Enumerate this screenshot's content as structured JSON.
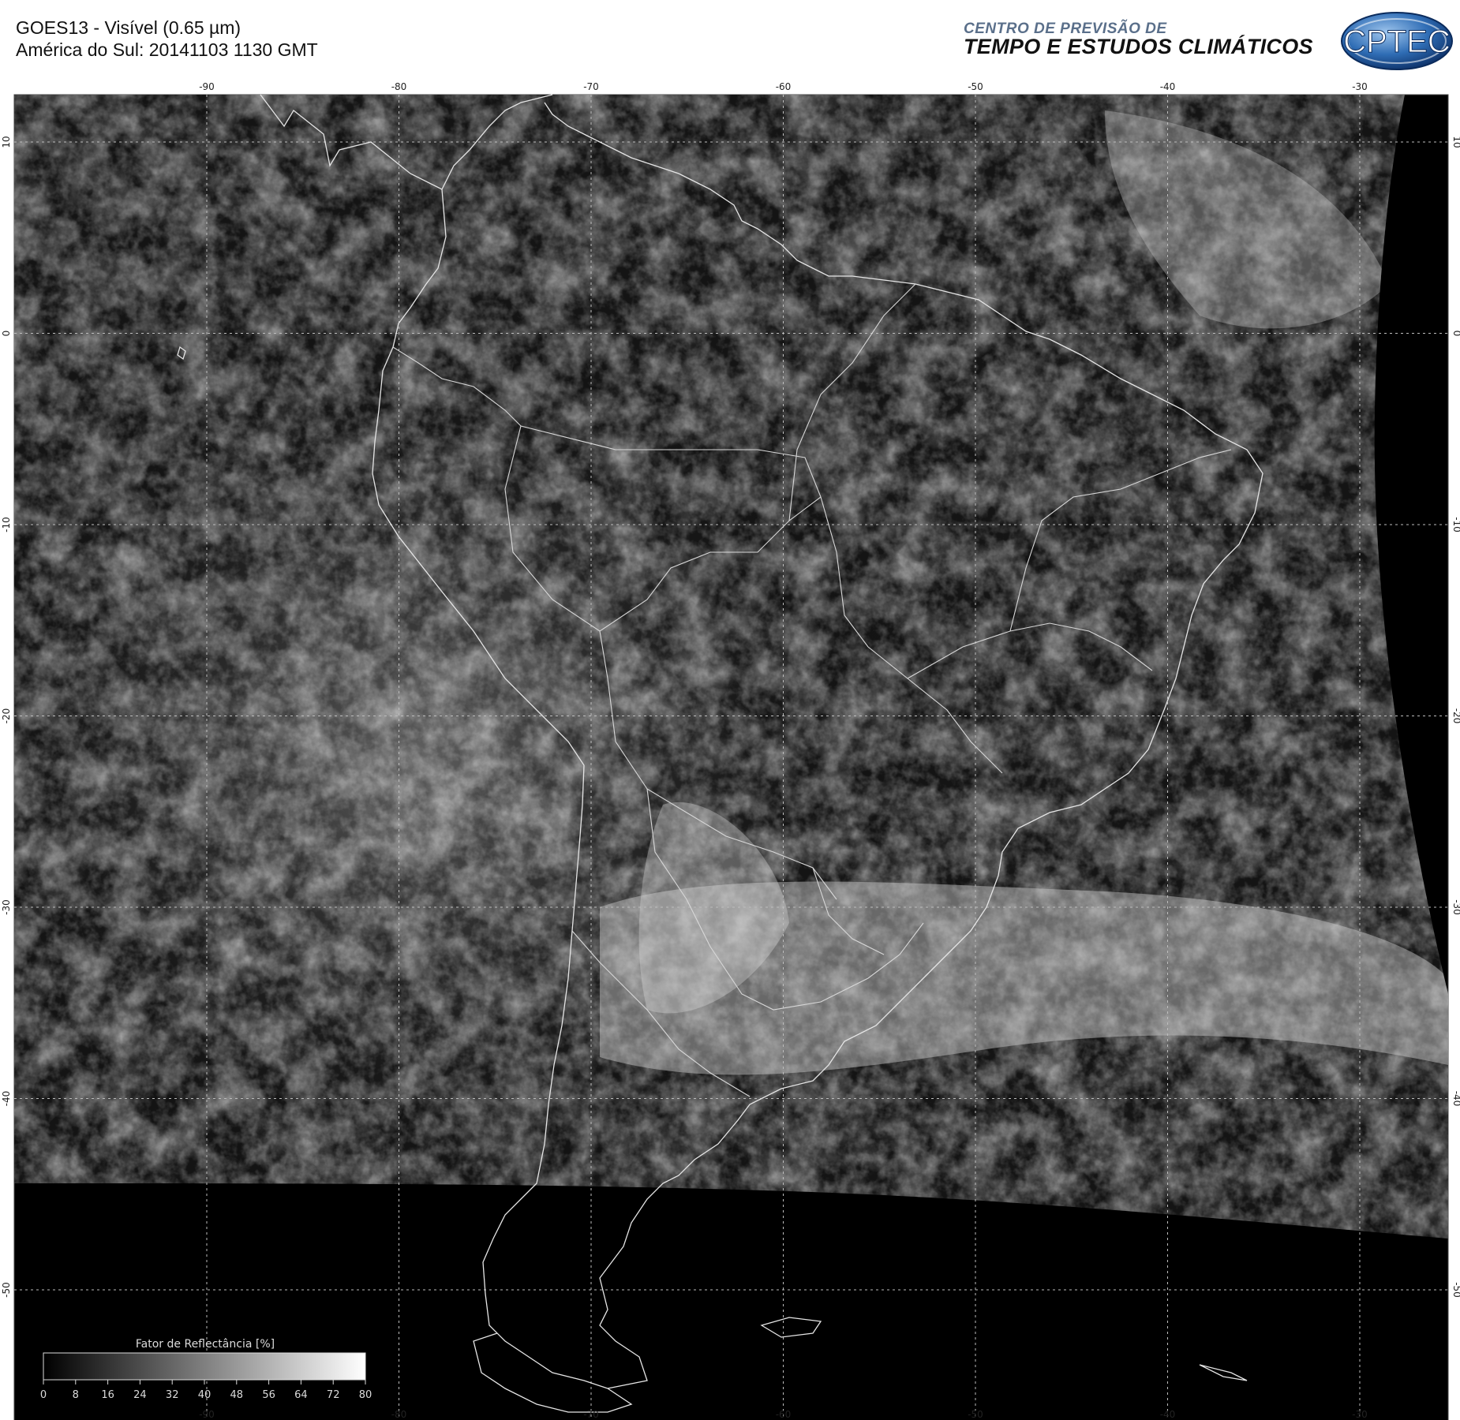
{
  "header": {
    "title_line1": "GOES13 - Visível (0.65 µm)",
    "title_line2": "América do Sul: 20141103 1130 GMT",
    "org_line1": "CENTRO DE PREVISÃO DE",
    "org_line2": "TEMPO E ESTUDOS CLIMÁTICOS",
    "logo_text": "CPTEC"
  },
  "map": {
    "lon_labels": [
      "-90",
      "-80",
      "-70",
      "-60",
      "-50",
      "-40",
      "-30"
    ],
    "lat_labels": [
      "10",
      "0",
      "-10",
      "-20",
      "-30",
      "-40",
      "-50"
    ]
  },
  "colorbar": {
    "title": "Fator de Reflectância [%]",
    "ticks": [
      "0",
      "8",
      "16",
      "24",
      "32",
      "40",
      "48",
      "56",
      "64",
      "72",
      "80"
    ]
  },
  "colors": {
    "background": "#000000",
    "coastline": "#e6e6e6",
    "gridline": "#bdbdbd",
    "logo_blue": "#1f5fa8"
  }
}
